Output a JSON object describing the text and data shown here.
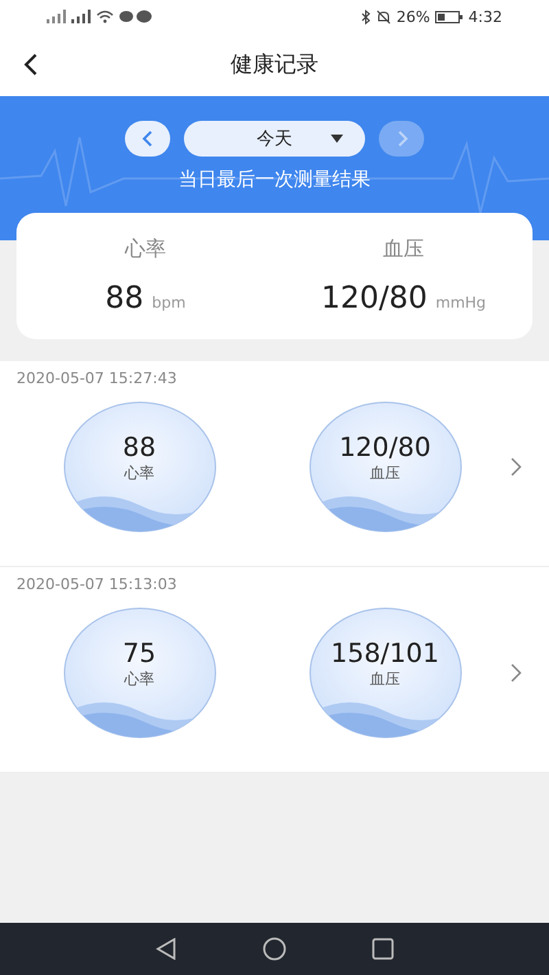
{
  "status_bar": {
    "battery_text": "26%",
    "time": "4:32"
  },
  "nav_bar": {
    "title": "健康记录"
  },
  "date_picker": {
    "prev": {
      "disabled": false
    },
    "value": "今天",
    "next": {
      "disabled": true
    }
  },
  "summary": {
    "caption": "当日最后一次测量结果",
    "metrics": [
      {
        "label": "心率",
        "value": "88",
        "unit": "bpm"
      },
      {
        "label": "血压",
        "value": "120/80",
        "unit": "mmHg"
      }
    ]
  },
  "records": [
    {
      "time": "2020-05-07 15:27:43",
      "readings": [
        {
          "value": "88",
          "label": "心率"
        },
        {
          "value": "120/80",
          "label": "血压"
        }
      ]
    },
    {
      "time": "2020-05-07 15:13:03",
      "readings": [
        {
          "value": "75",
          "label": "心率"
        },
        {
          "value": "158/101",
          "label": "血压"
        }
      ]
    }
  ]
}
